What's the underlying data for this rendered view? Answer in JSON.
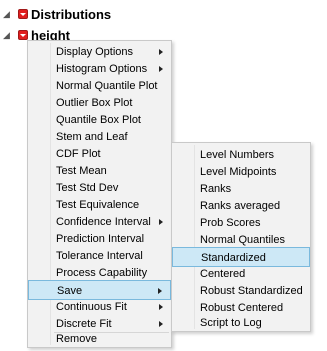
{
  "window": {
    "title": "Distributions",
    "subtitle": "height"
  },
  "menu": {
    "items": [
      {
        "label": "Display Options",
        "submenu": true
      },
      {
        "label": "Histogram Options",
        "submenu": true
      },
      {
        "label": "Normal Quantile Plot",
        "submenu": false
      },
      {
        "label": "Outlier Box Plot",
        "submenu": false
      },
      {
        "label": "Quantile Box Plot",
        "submenu": false
      },
      {
        "label": "Stem and Leaf",
        "submenu": false
      },
      {
        "label": "CDF Plot",
        "submenu": false
      },
      {
        "label": "Test Mean",
        "submenu": false
      },
      {
        "label": "Test Std Dev",
        "submenu": false
      },
      {
        "label": "Test Equivalence",
        "submenu": false
      },
      {
        "label": "Confidence Interval",
        "submenu": true
      },
      {
        "label": "Prediction Interval",
        "submenu": false
      },
      {
        "label": "Tolerance Interval",
        "submenu": false
      },
      {
        "label": "Process Capability",
        "submenu": false
      },
      {
        "label": "Save",
        "submenu": true,
        "highlighted": true
      },
      {
        "label": "Continuous Fit",
        "submenu": true
      },
      {
        "label": "Discrete Fit",
        "submenu": true
      },
      {
        "label": "Remove",
        "submenu": false
      }
    ]
  },
  "submenu": {
    "items": [
      {
        "label": "Level Numbers"
      },
      {
        "label": "Level Midpoints"
      },
      {
        "label": "Ranks"
      },
      {
        "label": "Ranks averaged"
      },
      {
        "label": "Prob Scores"
      },
      {
        "label": "Normal Quantiles"
      },
      {
        "label": "Standardized",
        "highlighted": true
      },
      {
        "label": "Centered"
      },
      {
        "label": "Robust Standardized"
      },
      {
        "label": "Robust Centered"
      },
      {
        "label": "Script to Log"
      }
    ]
  },
  "colors": {
    "highlight": "#cde8f6",
    "highlight_border": "#7ab9dd",
    "red_triangle": "#e11d1d"
  }
}
